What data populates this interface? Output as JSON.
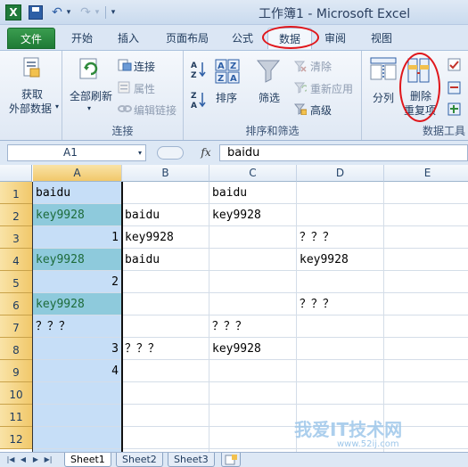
{
  "app": {
    "title": "工作簿1 - Microsoft Excel",
    "logo_letter": "X"
  },
  "quick_access": {
    "save_icon": "save-icon",
    "undo_icon": "undo-icon",
    "redo_icon": "redo-icon"
  },
  "tabs": [
    {
      "label": "文件"
    },
    {
      "label": "开始"
    },
    {
      "label": "插入"
    },
    {
      "label": "页面布局"
    },
    {
      "label": "公式"
    },
    {
      "label": "数据"
    },
    {
      "label": "审阅"
    },
    {
      "label": "视图"
    }
  ],
  "ribbon": {
    "get_external": {
      "line1": "获取",
      "line2": "外部数据"
    },
    "connections": {
      "refresh_all": "全部刷新",
      "connections": "连接",
      "properties": "属性",
      "edit_links": "编辑链接",
      "group_label": "连接"
    },
    "sort_filter": {
      "sort": "排序",
      "filter": "筛选",
      "clear": "清除",
      "reapply": "重新应用",
      "advanced": "高级",
      "group_label": "排序和筛选"
    },
    "data_tools": {
      "split": "分列",
      "remove_dup_line1": "删除",
      "remove_dup_line2": "重复项",
      "group_label": "数据工具"
    }
  },
  "formula_bar": {
    "name_box": "A1",
    "fx": "fx",
    "value": "baidu"
  },
  "grid": {
    "columns": [
      "A",
      "B",
      "C",
      "D",
      "E"
    ],
    "rows": [
      "1",
      "2",
      "3",
      "4",
      "5",
      "6",
      "7",
      "8",
      "9",
      "10",
      "11",
      "12"
    ],
    "cells": {
      "A1": "baidu",
      "C1": "baidu",
      "A2": "key9928",
      "B2": "baidu",
      "C2": "key9928",
      "A3": "1",
      "B3": "key9928",
      "D3": "？？？",
      "A4": "key9928",
      "B4": "baidu",
      "D4": "key9928",
      "A5": "2",
      "A6": "key9928",
      "D6": "？？？",
      "A7": "？？？",
      "C7": "？？？",
      "A8": "3",
      "B8": "？？？",
      "C8": "key9928",
      "A9": "4"
    }
  },
  "sheets": [
    "Sheet1",
    "Sheet2",
    "Sheet3"
  ],
  "watermark": {
    "main": "我爱IT技术网",
    "sub": "www.52ij.com"
  },
  "colors": {
    "accent_green": "#1f7a35",
    "highlight": "#e0161b",
    "teal_cells": "#8ecadc"
  }
}
